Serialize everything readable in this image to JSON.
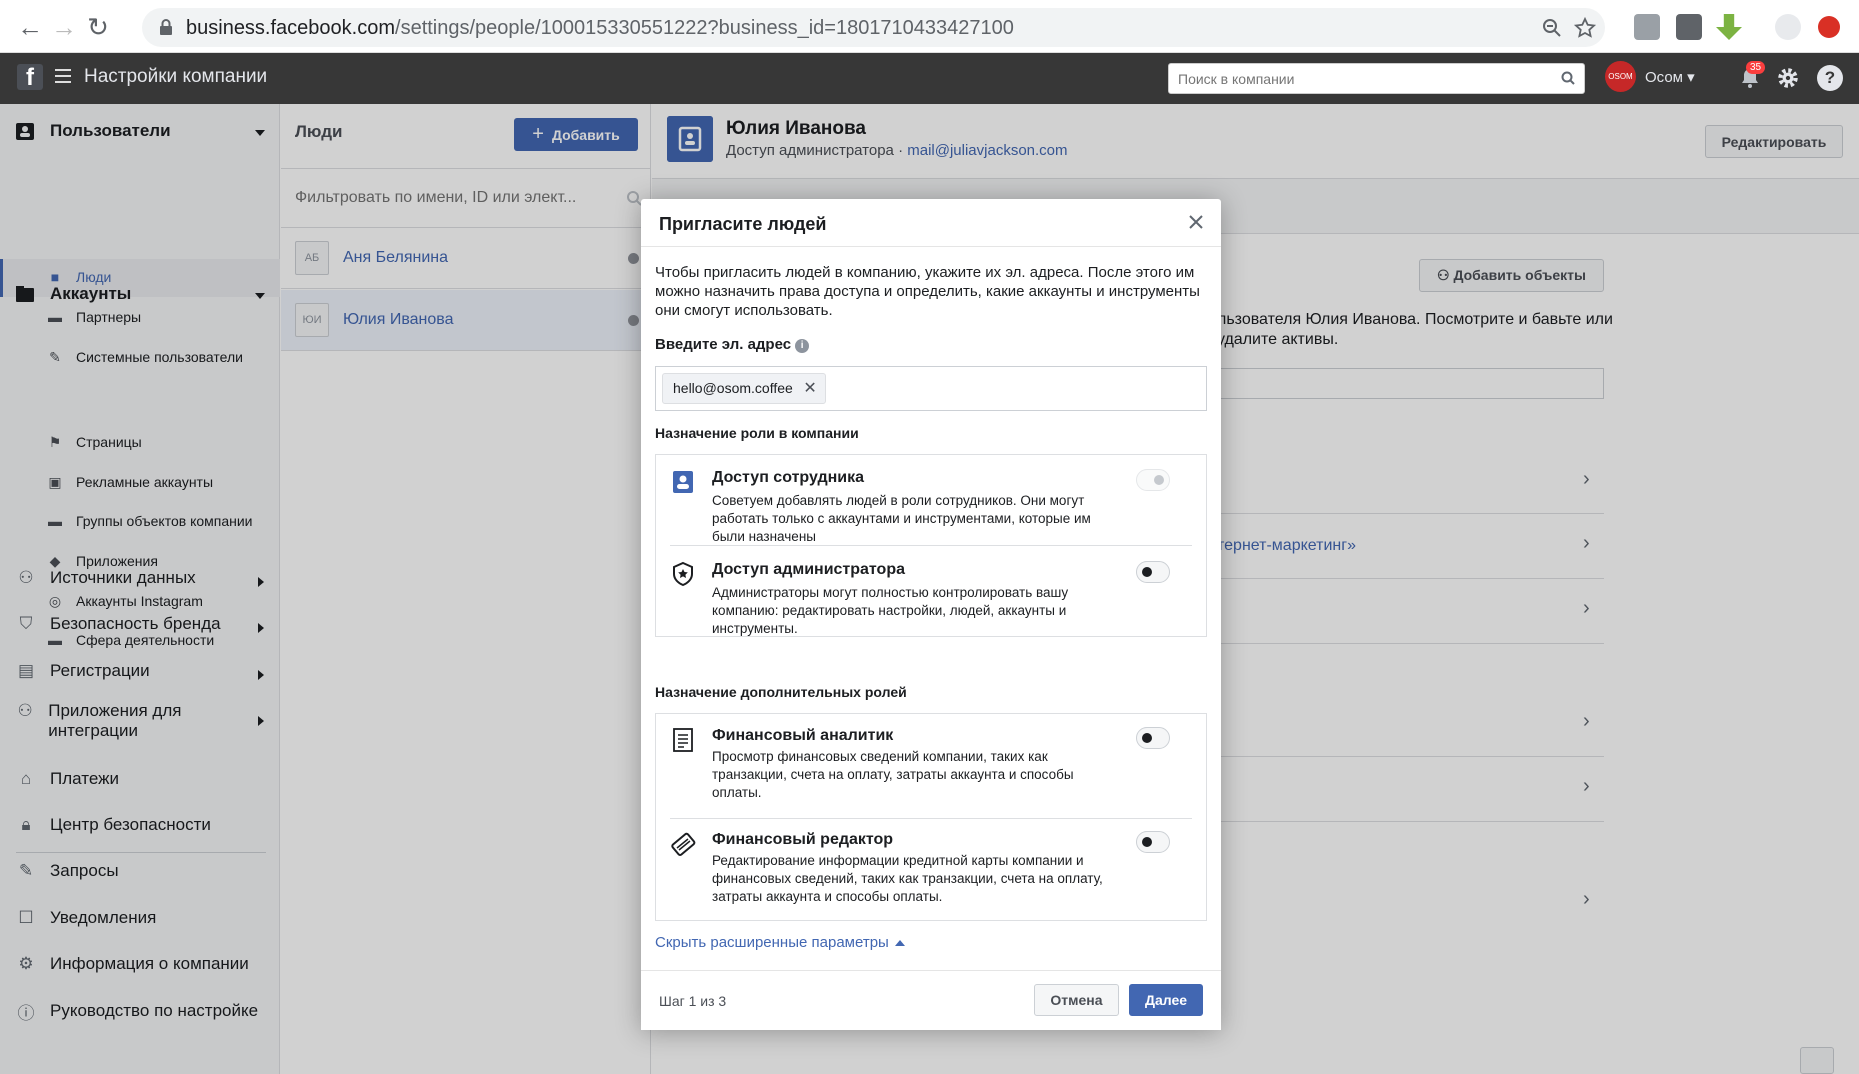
{
  "browser": {
    "url_host": "business.facebook.com",
    "url_rest": "/settings/people/100015330551222?business_id=1801710433427100"
  },
  "header": {
    "title": "Настройки компании",
    "search_placeholder": "Поиск в компании",
    "account_name": "Осом",
    "avatar_text": "OSOM",
    "notifications_count": "35",
    "help_label": "?"
  },
  "sidebar": {
    "users_section": "Пользователи",
    "users_items": [
      "Люди",
      "Партнеры",
      "Системные пользователи"
    ],
    "accounts_section": "Аккаунты",
    "accounts_items": [
      "Страницы",
      "Рекламные аккаунты",
      "Группы объектов компании",
      "Приложения",
      "Аккаунты Instagram",
      "Сфера деятельности"
    ],
    "collapsed_sections": [
      "Источники данных",
      "Безопасность бренда",
      "Регистрации",
      "Приложения для интеграции"
    ],
    "bottom_items": [
      "Платежи",
      "Центр безопасности",
      "Запросы",
      "Уведомления",
      "Информация о компании",
      "Руководство по настройке"
    ]
  },
  "people": {
    "heading": "Люди",
    "add_label": "Добавить",
    "filter_placeholder": "Фильтровать по имени, ID или элект...",
    "list": [
      {
        "initials": "АБ",
        "name": "Аня Белянина"
      },
      {
        "initials": "ЮИ",
        "name": "Юлия Иванова"
      }
    ]
  },
  "detail": {
    "name": "Юлия Иванова",
    "access": "Доступ администратора · ",
    "email": "mail@juliavjackson.com",
    "edit_label": "Редактировать",
    "add_objects_label": "Добавить объекты",
    "text_fragment": "льзователя Юлия Иванова. Посмотрите и бавьте или удалите активы.",
    "link_fragment": "тернет-маркетинг»"
  },
  "modal": {
    "title": "Пригласите людей",
    "intro": "Чтобы пригласить людей в компанию, укажите их эл. адреса. После этого им можно назначить права доступа и определить, какие аккаунты и инструменты они смогут использовать.",
    "email_label": "Введите эл. адрес",
    "email_chip": "hello@osom.coffee",
    "role_heading": "Назначение роли в компании",
    "roles": [
      {
        "title": "Доступ сотрудника",
        "desc": "Советуем добавлять людей в роли сотрудников. Они могут работать только с аккаунтами и инструментами, которые им были назначены"
      },
      {
        "title": "Доступ администратора",
        "desc": "Администраторы могут полностью контролировать вашу компанию: редактировать настройки, людей, аккаунты и инструменты."
      }
    ],
    "extra_heading": "Назначение дополнительных ролей",
    "extra_roles": [
      {
        "title": "Финансовый аналитик",
        "desc": "Просмотр финансовых сведений компании, таких как транзакции, счета на оплату, затраты аккаунта и способы оплаты."
      },
      {
        "title": "Финансовый редактор",
        "desc": "Редактирование информации кредитной карты компании и финансовых сведений, таких как транзакции, счета на оплату, затраты аккаунта и способы оплаты."
      }
    ],
    "hide_link": "Скрыть расширенные параметры",
    "step": "Шаг 1 из 3",
    "cancel": "Отмена",
    "next": "Далее"
  },
  "colors": {
    "accent": "#4267b2",
    "header_bg": "#373737",
    "sidebar_bg": "#f5f6f7"
  }
}
